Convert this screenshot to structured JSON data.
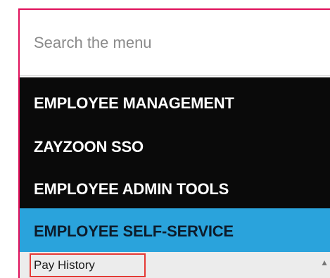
{
  "search": {
    "placeholder": "Search the menu"
  },
  "menu": {
    "items": [
      {
        "label": "EMPLOYEE MANAGEMENT"
      },
      {
        "label": "ZAYZOON SSO"
      },
      {
        "label": "EMPLOYEE ADMIN TOOLS"
      }
    ],
    "active": {
      "label": "EMPLOYEE SELF-SERVICE"
    },
    "submenu": [
      {
        "label": "Pay History"
      }
    ]
  },
  "colors": {
    "accent_border": "#e0105b",
    "menu_bg": "#0a0a0a",
    "active_bg": "#2aa3dc",
    "highlight_box": "#e53935"
  },
  "icons": {
    "submenu_indicator": "caret-up-icon"
  }
}
